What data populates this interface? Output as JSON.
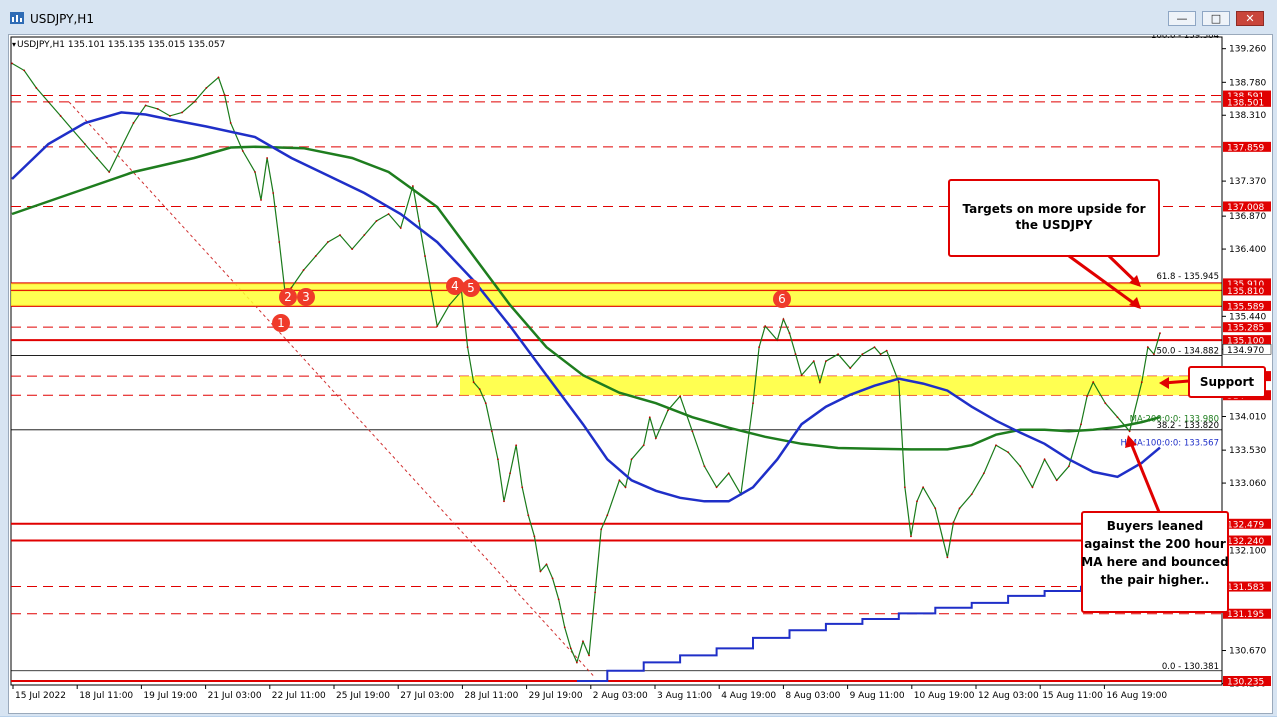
{
  "window": {
    "title": "USDJPY,H1",
    "buttons": {
      "minimize": "—",
      "maximize": "□",
      "close": "✕"
    }
  },
  "chart_header": {
    "symbol_info": "USDJPY,H1  135.101 135.135 135.015 135.057"
  },
  "chart_data": {
    "type": "line",
    "title": "",
    "y_range": [
      130.235,
      139.384
    ],
    "y_ticks": [
      "139.260",
      "138.780",
      "138.310",
      "137.370",
      "136.870",
      "136.400",
      "135.440",
      "134.970",
      "134.490",
      "134.010",
      "133.530",
      "133.060",
      "132.100",
      "130.670",
      "130.200"
    ],
    "x_labels": [
      "15 Jul 2022",
      "18 Jul 11:00",
      "19 Jul 19:00",
      "21 Jul 03:00",
      "22 Jul 11:00",
      "25 Jul 19:00",
      "27 Jul 03:00",
      "28 Jul 11:00",
      "29 Jul 19:00",
      "2 Aug 03:00",
      "3 Aug 11:00",
      "4 Aug 19:00",
      "8 Aug 03:00",
      "9 Aug 11:00",
      "10 Aug 19:00",
      "12 Aug 03:00",
      "15 Aug 11:00",
      "16 Aug 19:00"
    ],
    "horizontal_levels": [
      {
        "value": 138.591,
        "label": "138.591",
        "style": "dashed"
      },
      {
        "value": 138.501,
        "label": "138.501",
        "style": "dashed"
      },
      {
        "value": 137.859,
        "label": "137.859",
        "style": "dashed"
      },
      {
        "value": 137.008,
        "label": "137.008",
        "style": "dashed"
      },
      {
        "value": 135.91,
        "label": "135.910",
        "style": "solid"
      },
      {
        "value": 135.81,
        "label": "135.810",
        "style": "solid"
      },
      {
        "value": 135.589,
        "label": "135.589",
        "style": "solid"
      },
      {
        "value": 135.285,
        "label": "135.285",
        "style": "dashed"
      },
      {
        "value": 135.1,
        "label": "135.100",
        "style": "solid"
      },
      {
        "value": 134.587,
        "label": "587",
        "style": "dashed"
      },
      {
        "value": 134.314,
        "label": "314",
        "style": "dashed"
      },
      {
        "value": 132.479,
        "label": "132.479",
        "style": "solid"
      },
      {
        "value": 132.24,
        "label": "132.240",
        "style": "solid"
      },
      {
        "value": 131.583,
        "label": "131.583",
        "style": "dashed"
      },
      {
        "value": 131.195,
        "label": "131.195",
        "style": "dashed"
      },
      {
        "value": 130.235,
        "label": "130.235",
        "style": "solid"
      }
    ],
    "fib_labels": [
      {
        "value": 139.384,
        "label": "100.0 - 139.384"
      },
      {
        "value": 135.945,
        "label": "61.8 - 135.945"
      },
      {
        "value": 134.882,
        "label": "50.0 - 134.882"
      },
      {
        "value": 133.82,
        "label": "38.2 - 133.820"
      },
      {
        "value": 130.381,
        "label": "0.0 - 130.381"
      }
    ],
    "current_price": {
      "value": 134.97,
      "label": "134.970"
    },
    "ma_labels": {
      "ma200": "MA:200:0:0: 133.980",
      "ma100": "MA:100:0:0: 133.567",
      "ma100_prefix": "H"
    },
    "swing_numbers": [
      "1",
      "2",
      "3",
      "4",
      "5",
      "6"
    ],
    "price_series": [
      [
        0,
        139.05
      ],
      [
        2,
        138.95
      ],
      [
        4,
        138.7
      ],
      [
        6,
        138.5
      ],
      [
        8,
        138.3
      ],
      [
        10,
        138.1
      ],
      [
        12,
        137.9
      ],
      [
        14,
        137.7
      ],
      [
        16,
        137.5
      ],
      [
        18,
        137.85
      ],
      [
        20,
        138.2
      ],
      [
        22,
        138.45
      ],
      [
        24,
        138.4
      ],
      [
        26,
        138.3
      ],
      [
        28,
        138.35
      ],
      [
        30,
        138.5
      ],
      [
        32,
        138.7
      ],
      [
        34,
        138.85
      ],
      [
        35,
        138.6
      ],
      [
        36,
        138.2
      ],
      [
        38,
        137.8
      ],
      [
        40,
        137.5
      ],
      [
        41,
        137.1
      ],
      [
        42,
        137.7
      ],
      [
        43,
        137.2
      ],
      [
        44,
        136.5
      ],
      [
        45,
        135.75
      ],
      [
        46,
        135.85
      ],
      [
        48,
        136.1
      ],
      [
        50,
        136.3
      ],
      [
        52,
        136.5
      ],
      [
        54,
        136.6
      ],
      [
        56,
        136.4
      ],
      [
        58,
        136.6
      ],
      [
        60,
        136.8
      ],
      [
        62,
        136.9
      ],
      [
        64,
        136.7
      ],
      [
        66,
        137.3
      ],
      [
        67,
        136.8
      ],
      [
        68,
        136.3
      ],
      [
        69,
        135.8
      ],
      [
        70,
        135.3
      ],
      [
        72,
        135.6
      ],
      [
        74,
        135.8
      ],
      [
        75,
        135.0
      ],
      [
        76,
        134.5
      ],
      [
        77,
        134.4
      ],
      [
        78,
        134.2
      ],
      [
        79,
        133.8
      ],
      [
        80,
        133.4
      ],
      [
        81,
        132.8
      ],
      [
        82,
        133.2
      ],
      [
        83,
        133.6
      ],
      [
        84,
        133.0
      ],
      [
        85,
        132.6
      ],
      [
        86,
        132.3
      ],
      [
        87,
        131.8
      ],
      [
        88,
        131.9
      ],
      [
        89,
        131.7
      ],
      [
        90,
        131.4
      ],
      [
        91,
        131.0
      ],
      [
        92,
        130.7
      ],
      [
        93,
        130.5
      ],
      [
        94,
        130.8
      ],
      [
        95,
        130.6
      ],
      [
        96,
        131.5
      ],
      [
        97,
        132.4
      ],
      [
        98,
        132.6
      ],
      [
        100,
        133.1
      ],
      [
        101,
        133.0
      ],
      [
        102,
        133.4
      ],
      [
        104,
        133.6
      ],
      [
        105,
        134.0
      ],
      [
        106,
        133.7
      ],
      [
        108,
        134.1
      ],
      [
        110,
        134.3
      ],
      [
        112,
        133.8
      ],
      [
        114,
        133.3
      ],
      [
        116,
        133.0
      ],
      [
        118,
        133.2
      ],
      [
        120,
        132.9
      ],
      [
        122,
        134.2
      ],
      [
        123,
        135.0
      ],
      [
        124,
        135.3
      ],
      [
        126,
        135.1
      ],
      [
        127,
        135.4
      ],
      [
        128,
        135.2
      ],
      [
        129,
        134.9
      ],
      [
        130,
        134.6
      ],
      [
        132,
        134.8
      ],
      [
        133,
        134.5
      ],
      [
        134,
        134.8
      ],
      [
        136,
        134.9
      ],
      [
        138,
        134.7
      ],
      [
        140,
        134.9
      ],
      [
        142,
        135.0
      ],
      [
        143,
        134.9
      ],
      [
        144,
        134.95
      ],
      [
        146,
        134.5
      ],
      [
        147,
        133.0
      ],
      [
        148,
        132.3
      ],
      [
        149,
        132.8
      ],
      [
        150,
        133.0
      ],
      [
        152,
        132.7
      ],
      [
        154,
        132.0
      ],
      [
        155,
        132.5
      ],
      [
        156,
        132.7
      ],
      [
        158,
        132.9
      ],
      [
        160,
        133.2
      ],
      [
        162,
        133.6
      ],
      [
        164,
        133.5
      ],
      [
        166,
        133.3
      ],
      [
        168,
        133.0
      ],
      [
        170,
        133.4
      ],
      [
        172,
        133.1
      ],
      [
        174,
        133.3
      ],
      [
        176,
        133.9
      ],
      [
        177,
        134.3
      ],
      [
        178,
        134.5
      ],
      [
        180,
        134.2
      ],
      [
        182,
        134.0
      ],
      [
        184,
        133.8
      ],
      [
        186,
        134.5
      ],
      [
        187,
        135.0
      ],
      [
        188,
        134.9
      ],
      [
        189,
        135.2
      ]
    ],
    "ma200_series": [
      [
        0,
        136.9
      ],
      [
        10,
        137.2
      ],
      [
        20,
        137.5
      ],
      [
        30,
        137.7
      ],
      [
        36,
        137.85
      ],
      [
        40,
        137.86
      ],
      [
        48,
        137.84
      ],
      [
        56,
        137.7
      ],
      [
        62,
        137.5
      ],
      [
        70,
        137.0
      ],
      [
        76,
        136.3
      ],
      [
        82,
        135.6
      ],
      [
        88,
        135.0
      ],
      [
        94,
        134.6
      ],
      [
        100,
        134.35
      ],
      [
        106,
        134.2
      ],
      [
        112,
        134.0
      ],
      [
        118,
        133.85
      ],
      [
        124,
        133.72
      ],
      [
        130,
        133.62
      ],
      [
        136,
        133.56
      ],
      [
        142,
        133.55
      ],
      [
        148,
        133.54
      ],
      [
        154,
        133.54
      ],
      [
        158,
        133.6
      ],
      [
        162,
        133.75
      ],
      [
        166,
        133.82
      ],
      [
        170,
        133.82
      ],
      [
        174,
        133.8
      ],
      [
        178,
        133.82
      ],
      [
        182,
        133.86
      ],
      [
        186,
        133.93
      ],
      [
        189,
        134.0
      ]
    ],
    "ma100_series": [
      [
        0,
        137.4
      ],
      [
        6,
        137.9
      ],
      [
        12,
        138.2
      ],
      [
        18,
        138.35
      ],
      [
        22,
        138.32
      ],
      [
        26,
        138.25
      ],
      [
        32,
        138.15
      ],
      [
        40,
        138.0
      ],
      [
        46,
        137.7
      ],
      [
        52,
        137.45
      ],
      [
        58,
        137.2
      ],
      [
        64,
        136.9
      ],
      [
        70,
        136.5
      ],
      [
        76,
        135.95
      ],
      [
        82,
        135.3
      ],
      [
        88,
        134.6
      ],
      [
        94,
        133.9
      ],
      [
        98,
        133.4
      ],
      [
        102,
        133.1
      ],
      [
        106,
        132.95
      ],
      [
        110,
        132.85
      ],
      [
        114,
        132.8
      ],
      [
        118,
        132.8
      ],
      [
        122,
        133.0
      ],
      [
        126,
        133.4
      ],
      [
        130,
        133.9
      ],
      [
        134,
        134.15
      ],
      [
        138,
        134.32
      ],
      [
        142,
        134.45
      ],
      [
        146,
        134.55
      ],
      [
        150,
        134.48
      ],
      [
        154,
        134.38
      ],
      [
        158,
        134.15
      ],
      [
        162,
        133.95
      ],
      [
        166,
        133.78
      ],
      [
        170,
        133.62
      ],
      [
        174,
        133.4
      ],
      [
        178,
        133.22
      ],
      [
        182,
        133.15
      ],
      [
        186,
        133.35
      ],
      [
        189,
        133.567
      ]
    ],
    "bottom_step_series": [
      [
        93,
        130.235
      ],
      [
        98,
        130.38
      ],
      [
        104,
        130.5
      ],
      [
        110,
        130.6
      ],
      [
        116,
        130.7
      ],
      [
        122,
        130.85
      ],
      [
        128,
        130.96
      ],
      [
        134,
        131.05
      ],
      [
        140,
        131.12
      ],
      [
        146,
        131.2
      ],
      [
        152,
        131.28
      ],
      [
        158,
        131.35
      ],
      [
        164,
        131.45
      ],
      [
        170,
        131.52
      ],
      [
        176,
        131.58
      ],
      [
        182,
        131.65
      ]
    ],
    "x_count": 190
  },
  "annotations": {
    "targets": "Targets on more upside for the USDJPY",
    "support": "Support",
    "buyers": "Buyers leaned against the 200 hour MA here and bounced the pair higher.."
  }
}
